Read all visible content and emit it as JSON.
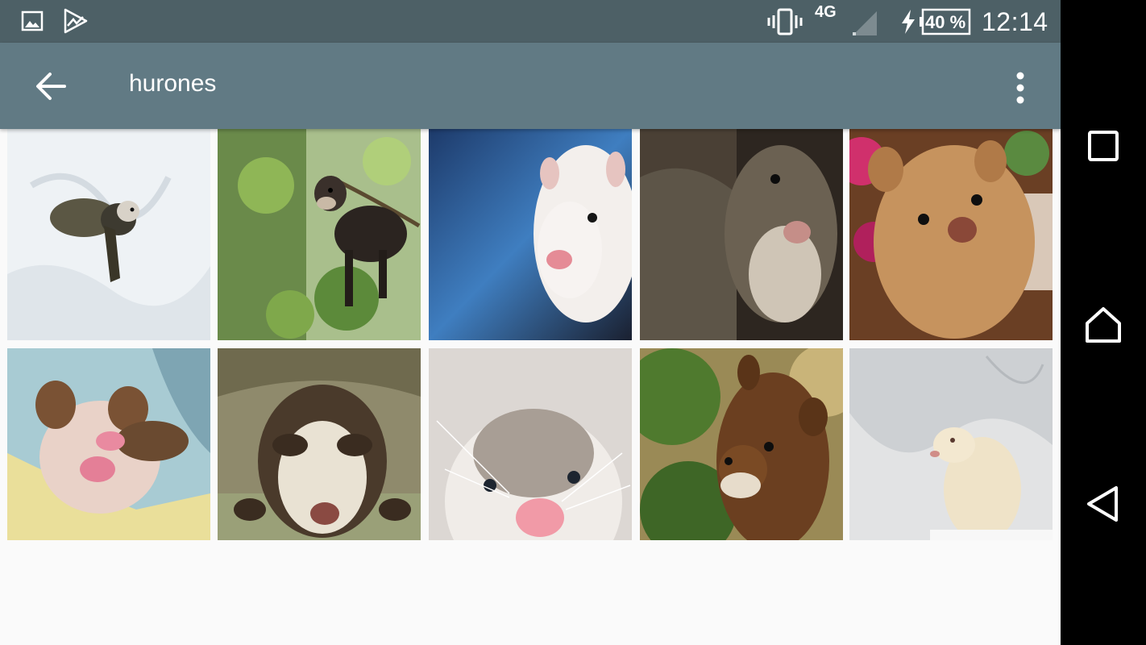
{
  "status_bar": {
    "network": "4G",
    "battery_percent": "40 %",
    "time": "12:14",
    "icons": [
      "image-notification-icon",
      "play-store-notification-icon",
      "vibrate-icon",
      "signal-icon",
      "charging-icon",
      "battery-icon"
    ]
  },
  "app_bar": {
    "title": "hurones",
    "back_icon": "arrow-back-icon",
    "menu_icon": "more-vert-icon"
  },
  "gallery": {
    "images": [
      {
        "subject": "ferret in snow",
        "bg": "#e9eef2"
      },
      {
        "subject": "dark ferret on tree branch",
        "bg": "#8aa86a"
      },
      {
        "subject": "white ferret close-up",
        "bg": "#3a5f95"
      },
      {
        "subject": "dark ferret close-up",
        "bg": "#4b4237"
      },
      {
        "subject": "golden ferret with flowers",
        "bg": "#b8844f"
      },
      {
        "subject": "sleeping ferret on blanket",
        "bg": "#9fc0c8"
      },
      {
        "subject": "sable ferret peeking",
        "bg": "#8e8a6a"
      },
      {
        "subject": "white ferret face",
        "bg": "#dcd7d3"
      },
      {
        "subject": "brown ferret portrait",
        "bg": "#5d7e35"
      },
      {
        "subject": "cream ferret in snow",
        "bg": "#d7d9db"
      }
    ]
  },
  "nav_bar": {
    "items": [
      "recents-button",
      "home-button",
      "back-button"
    ]
  }
}
